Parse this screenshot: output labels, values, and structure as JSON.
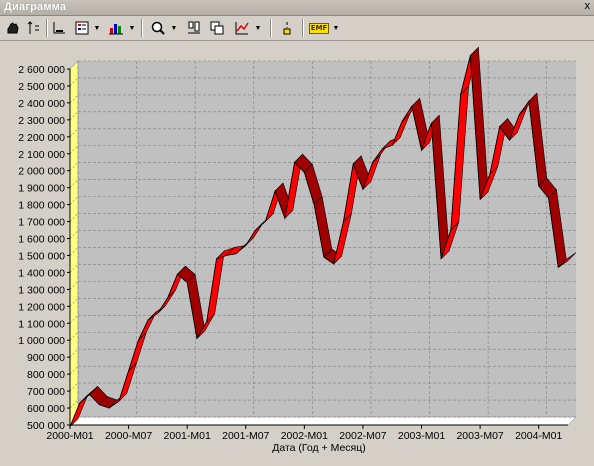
{
  "window": {
    "title": "Диаграмма",
    "close_label": "x"
  },
  "toolbar": {
    "icons": [
      "hand-icon",
      "axis-icon",
      "axis-ruler-icon",
      "legend-icon",
      "chart-type-icon",
      "zoom-icon",
      "align-icon",
      "copy-icon",
      "line-chart-icon",
      "cursor-icon",
      "emf-icon"
    ],
    "emf_label": "EMF"
  },
  "colors": {
    "series_front": "#ff0000",
    "series_top": "#a00000",
    "wall": "#c0c0c0",
    "floor": "#ffffff",
    "side": "#ffff80"
  },
  "chart_data": {
    "type": "line",
    "xlabel": "Дата (Год + Месяц)",
    "ylabel": "",
    "ylim": [
      500000,
      2600000
    ],
    "ytick_step": 100000,
    "yticks": [
      "500 000",
      "600 000",
      "700 000",
      "800 000",
      "900 000",
      "1 000 000",
      "1 100 000",
      "1 200 000",
      "1 300 000",
      "1 400 000",
      "1 500 000",
      "1 600 000",
      "1 700 000",
      "1 800 000",
      "1 900 000",
      "2 000 000",
      "2 100 000",
      "2 200 000",
      "2 300 000",
      "2 400 000",
      "2 500 000",
      "2 600 000"
    ],
    "xticks": [
      "2000-M01",
      "2000-M07",
      "2001-M01",
      "2001-M07",
      "2002-M01",
      "2002-M07",
      "2003-M01",
      "2003-M07",
      "2004-M01"
    ],
    "grid": true,
    "legend": "none",
    "series": [
      {
        "values": [
          490000,
          630000,
          680000,
          620000,
          600000,
          640000,
          820000,
          1000000,
          1120000,
          1160000,
          1250000,
          1390000,
          1340000,
          1010000,
          1110000,
          1480000,
          1500000,
          1510000,
          1560000,
          1650000,
          1700000,
          1880000,
          1720000,
          2050000,
          1990000,
          1800000,
          1490000,
          1450000,
          1700000,
          2040000,
          1890000,
          2050000,
          2130000,
          2150000,
          2290000,
          2380000,
          2120000,
          2280000,
          1480000,
          1650000,
          2450000,
          2680000,
          1830000,
          1980000,
          2260000,
          2180000,
          2330000,
          2410000,
          1910000,
          1840000,
          1430000,
          1470000
        ]
      }
    ]
  }
}
